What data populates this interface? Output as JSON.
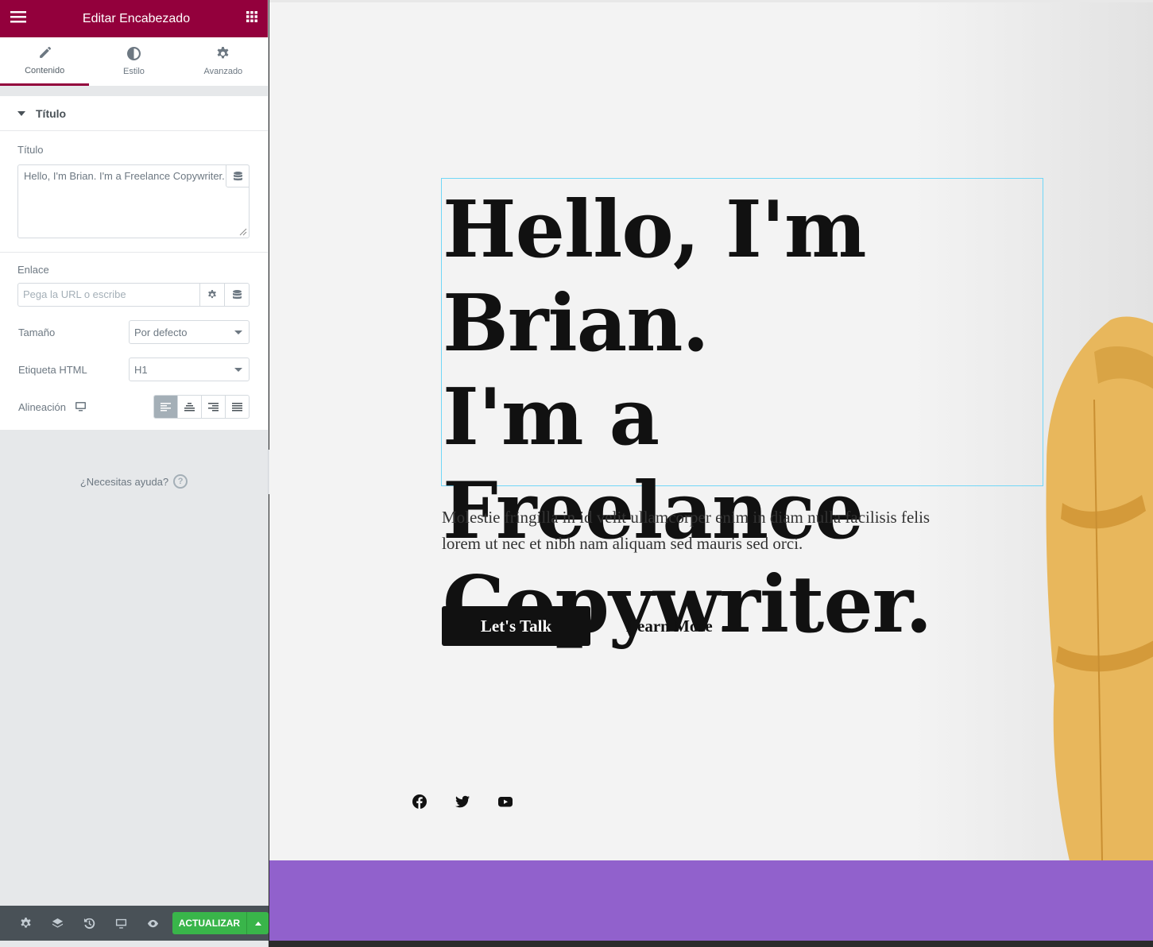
{
  "panel": {
    "header_title": "Editar Encabezado",
    "menu_icon": "hamburger-icon",
    "widgets_icon": "grid-icon",
    "tabs": [
      {
        "label": "Contenido",
        "icon": "pencil-icon",
        "active": true
      },
      {
        "label": "Estilo",
        "icon": "contrast-icon",
        "active": false
      },
      {
        "label": "Avanzado",
        "icon": "gear-icon",
        "active": false
      }
    ],
    "section_title": "Título",
    "title_label": "Título",
    "title_value": "Hello, I'm Brian. I'm a Freelance Copywriter.",
    "link_label": "Enlace",
    "link_placeholder": "Pega la URL o escribe",
    "size_label": "Tamaño",
    "size_value": "Por defecto",
    "tag_label": "Etiqueta HTML",
    "tag_value": "H1",
    "align_label": "Alineación",
    "help_text": "¿Necesitas ayuda?",
    "update_label": "ACTUALIZAR"
  },
  "canvas": {
    "heading_lines": [
      "Hello, I'm Brian.",
      "I'm a Freelance",
      "Copywriter."
    ],
    "paragraph": "Molestie fringilla in id velit ullamcorper enim in diam nulla facilisis felis lorem ut nec et nibh nam aliquam sed mauris sed orci.",
    "primary_button": "Let's Talk",
    "secondary_link": "Learn More",
    "social_icons": [
      "facebook-icon",
      "twitter-icon",
      "youtube-icon"
    ]
  },
  "colors": {
    "brand": "#93003c",
    "update_green": "#39b54a",
    "purple_band": "#9161cc",
    "canvas_bg": "#f3f3f3"
  }
}
